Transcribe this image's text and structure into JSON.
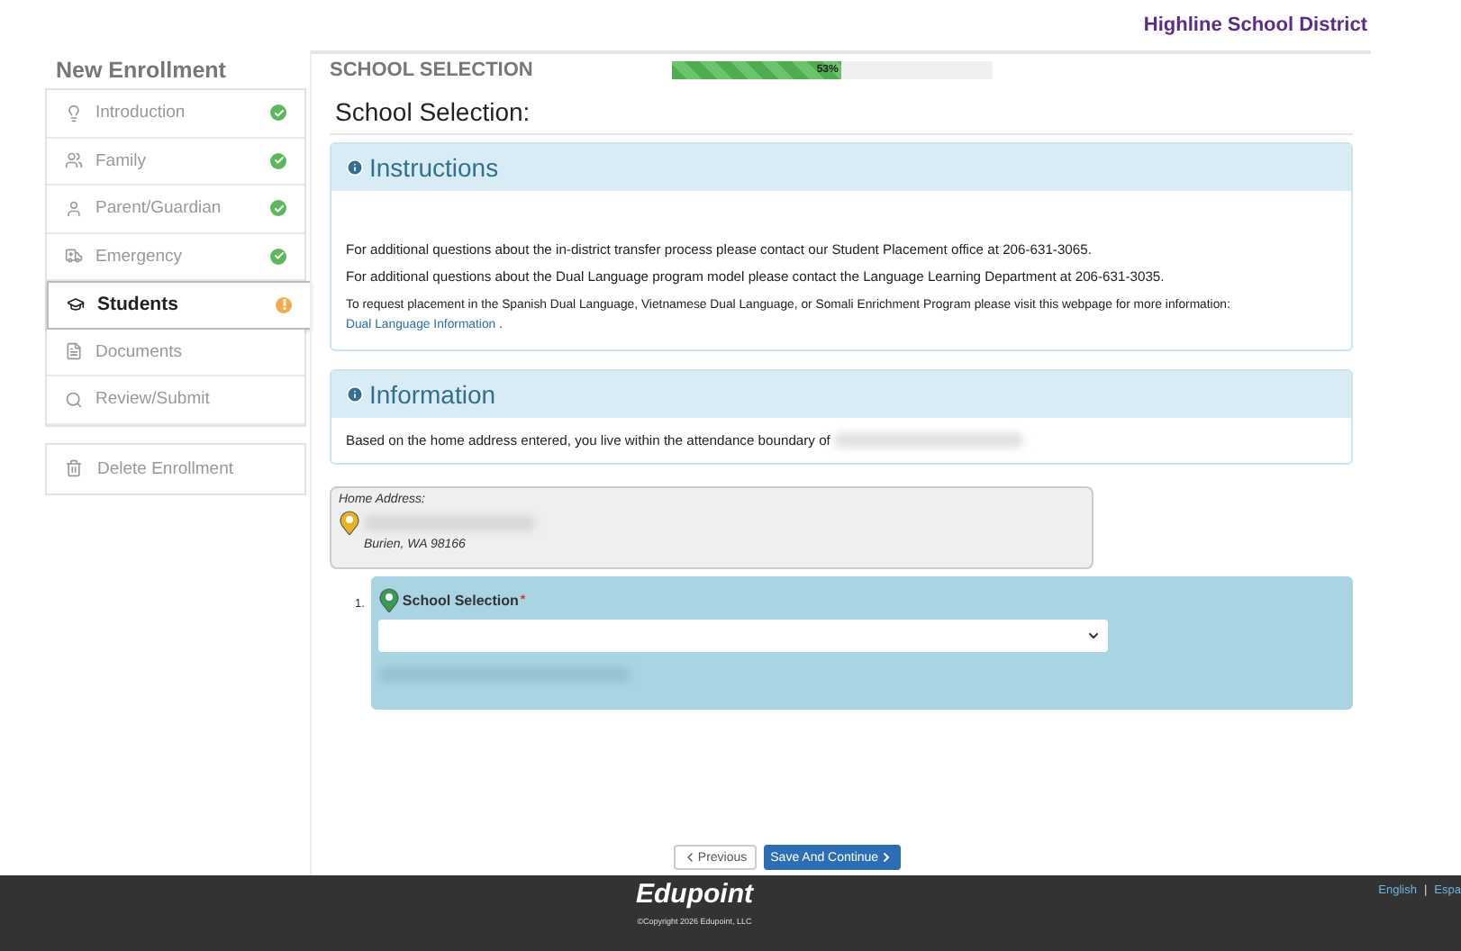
{
  "header": {
    "district": "Highline School District"
  },
  "sidebar": {
    "title": "New Enrollment",
    "items": [
      {
        "label": "Introduction",
        "kind": "done",
        "selected": false
      },
      {
        "label": "Family",
        "kind": "done",
        "selected": false
      },
      {
        "label": "Parent/Guardian",
        "kind": "done",
        "selected": false
      },
      {
        "label": "Emergency",
        "kind": "done",
        "selected": false
      },
      {
        "label": "Students",
        "kind": "warning",
        "selected": true
      },
      {
        "label": "Documents",
        "kind": "pending",
        "selected": false
      },
      {
        "label": "Review/Submit",
        "kind": "pending",
        "selected": false
      }
    ],
    "delete": "Delete Enrollment"
  },
  "section": {
    "title": "SCHOOL SELECTION",
    "progress": {
      "level": 0.53,
      "reading": "53%"
    }
  },
  "page_title": "School Selection:",
  "instructions": {
    "title": "Instructions",
    "lines": [
      "For additional questions about the in-district transfer process please contact our Student Placement office at 206-631-3065.",
      "For additional questions about the Dual Language program model please contact the Language Learning Department at 206-631-3035."
    ],
    "note": "To request placement in the Spanish Dual Language, Vietnamese Dual Language, or Somali Enrichment Program please visit this webpage for more information:",
    "link": "Dual Language Information",
    "note_end": "."
  },
  "information": {
    "title": "Information",
    "text": "Based on the home address entered, you live within the attendance boundary of"
  },
  "home_address": {
    "label": "Home Address:",
    "city": "Burien, WA 98166"
  },
  "school_selection": {
    "number": "1.",
    "label": "School Selection",
    "required": "*"
  },
  "buttons": {
    "previous": "Previous",
    "next": "Save And Continue"
  },
  "footer": {
    "logo": "Edupoint",
    "copyright": "©Copyright 2026 Edupoint, LLC",
    "languages": [
      "English",
      "Espa"
    ],
    "separator": "|"
  }
}
